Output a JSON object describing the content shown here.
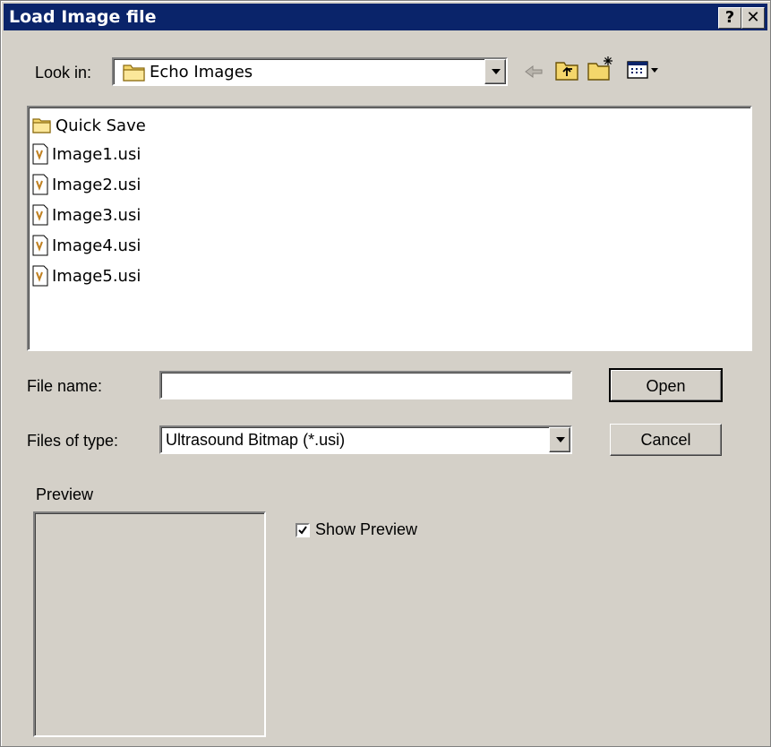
{
  "window": {
    "title": "Load Image file",
    "help_button": "?",
    "close_button": "✕"
  },
  "lookin": {
    "label": "Look in:",
    "value": "Echo Images"
  },
  "file_list": [
    {
      "name": "Quick Save",
      "type": "folder"
    },
    {
      "name": "Image1.usi",
      "type": "file"
    },
    {
      "name": "Image2.usi",
      "type": "file"
    },
    {
      "name": "Image3.usi",
      "type": "file"
    },
    {
      "name": "Image4.usi",
      "type": "file"
    },
    {
      "name": "Image5.usi",
      "type": "file"
    }
  ],
  "filename": {
    "label": "File name:",
    "value": ""
  },
  "filetype": {
    "label": "Files of type:",
    "value": "Ultrasound Bitmap (*.usi)"
  },
  "buttons": {
    "open": "Open",
    "cancel": "Cancel"
  },
  "preview": {
    "label": "Preview",
    "show_preview_label": "Show Preview",
    "show_preview_checked": true
  }
}
